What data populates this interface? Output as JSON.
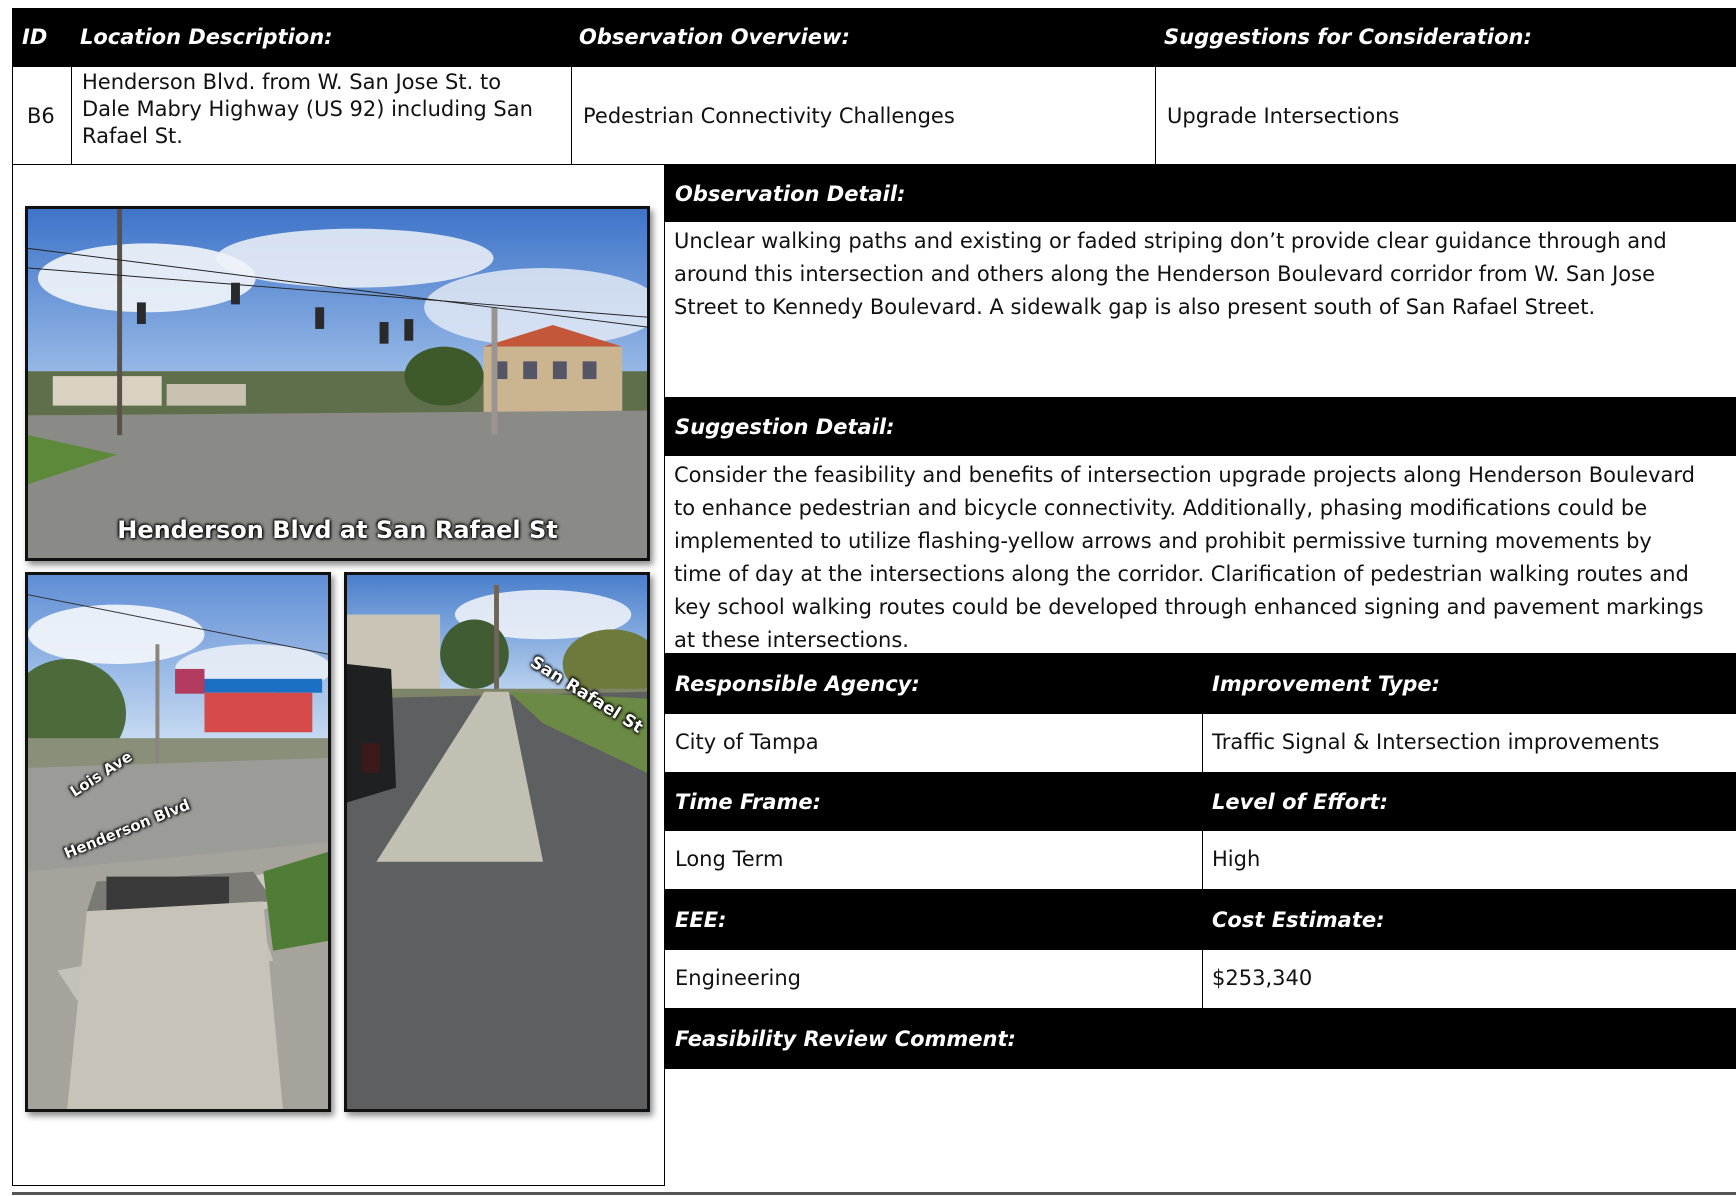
{
  "header": {
    "id": "ID",
    "location": "Location Description:",
    "observation": "Observation Overview:",
    "suggestions": "Suggestions for Consideration:"
  },
  "row": {
    "id": "B6",
    "location_lines": [
      "Henderson Blvd. from W. San Jose St. to",
      "Dale Mabry Highway (US 92) including San",
      "Rafael St."
    ],
    "observation": "Pedestrian Connectivity Challenges",
    "suggestion": "Upgrade Intersections"
  },
  "photos": {
    "main_caption": "Henderson Blvd at San Rafael St",
    "left_label_1": "Lois Ave",
    "left_label_2": "Henderson Blvd",
    "right_label": "San Rafael St"
  },
  "observation_detail": {
    "heading": "Observation Detail:",
    "lines": [
      "Unclear walking paths and existing or faded striping don’t provide clear guidance through and",
      "around this intersection and others along the Henderson Boulevard corridor from W. San Jose",
      "Street to Kennedy Boulevard. A sidewalk gap is also present south of San Rafael Street."
    ]
  },
  "suggestion_detail": {
    "heading": "Suggestion Detail:",
    "lines": [
      "Consider the feasibility and benefits of intersection upgrade projects along Henderson Boulevard",
      "to enhance pedestrian and bicycle connectivity. Additionally, phasing modifications could be",
      "implemented to utilize flashing-yellow arrows and prohibit permissive turning movements by",
      "time of day at the intersections along the corridor. Clarification of pedestrian walking routes and",
      "key school walking routes could be developed through enhanced signing and pavement markings",
      "at these intersections."
    ]
  },
  "details": {
    "responsible_agency_label": "Responsible Agency:",
    "responsible_agency": "City of Tampa",
    "improvement_type_label": "Improvement Type:",
    "improvement_type": "Traffic Signal & Intersection improvements",
    "time_frame_label": "Time Frame:",
    "time_frame": "Long Term",
    "level_of_effort_label": "Level of Effort:",
    "level_of_effort": "High",
    "eee_label": "EEE:",
    "eee": "Engineering",
    "cost_estimate_label": "Cost Estimate:",
    "cost_estimate": "$253,340",
    "feasibility_label": "Feasibility Review Comment:",
    "feasibility": ""
  }
}
